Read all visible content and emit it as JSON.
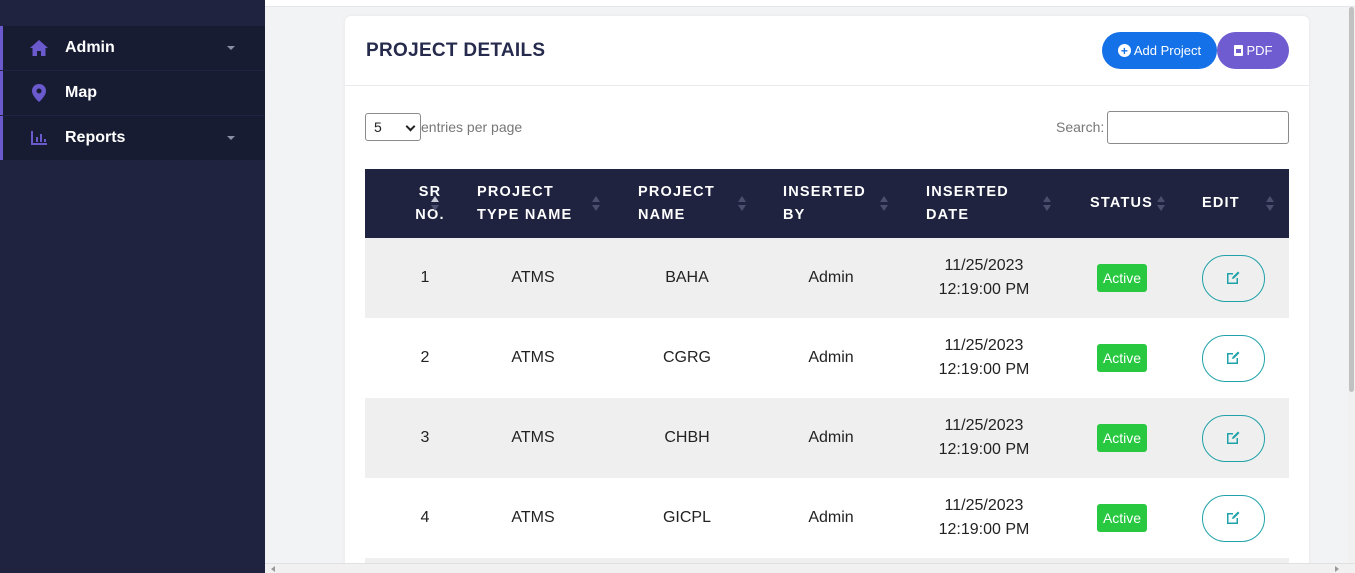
{
  "sidebar": {
    "items": [
      {
        "label": "Admin",
        "icon": "home-icon",
        "has_caret": true
      },
      {
        "label": "Map",
        "icon": "map-marker-icon",
        "has_caret": false
      },
      {
        "label": "Reports",
        "icon": "bar-chart-icon",
        "has_caret": true
      }
    ]
  },
  "card": {
    "title": "PROJECT DETAILS",
    "add_button": "Add Project",
    "pdf_button": "PDF"
  },
  "controls": {
    "entries_value": "5",
    "entries_label": "entries per page",
    "search_label": "Search:",
    "search_value": ""
  },
  "table": {
    "headers": [
      {
        "line1": "SR",
        "line2": "NO."
      },
      {
        "line1": "PROJECT",
        "line2": "TYPE NAME"
      },
      {
        "line1": "PROJECT",
        "line2": "NAME"
      },
      {
        "line1": "INSERTED",
        "line2": "BY"
      },
      {
        "line1": "INSERTED",
        "line2": "DATE"
      },
      {
        "line1": "STATUS",
        "line2": ""
      },
      {
        "line1": "EDIT",
        "line2": ""
      }
    ],
    "rows": [
      {
        "sr": "1",
        "type": "ATMS",
        "name": "BAHA",
        "by": "Admin",
        "date": "11/25/2023",
        "time": "12:19:00 PM",
        "status": "Active"
      },
      {
        "sr": "2",
        "type": "ATMS",
        "name": "CGRG",
        "by": "Admin",
        "date": "11/25/2023",
        "time": "12:19:00 PM",
        "status": "Active"
      },
      {
        "sr": "3",
        "type": "ATMS",
        "name": "CHBH",
        "by": "Admin",
        "date": "11/25/2023",
        "time": "12:19:00 PM",
        "status": "Active"
      },
      {
        "sr": "4",
        "type": "ATMS",
        "name": "GICPL",
        "by": "Admin",
        "date": "11/25/2023",
        "time": "12:19:00 PM",
        "status": "Active"
      }
    ]
  },
  "colors": {
    "sidebar_bg": "#1f2340",
    "accent": "#6a5acd",
    "primary": "#1471e8",
    "pdf": "#6f5cd0",
    "status_active": "#28c940",
    "edit_border": "#1fa2a8"
  }
}
